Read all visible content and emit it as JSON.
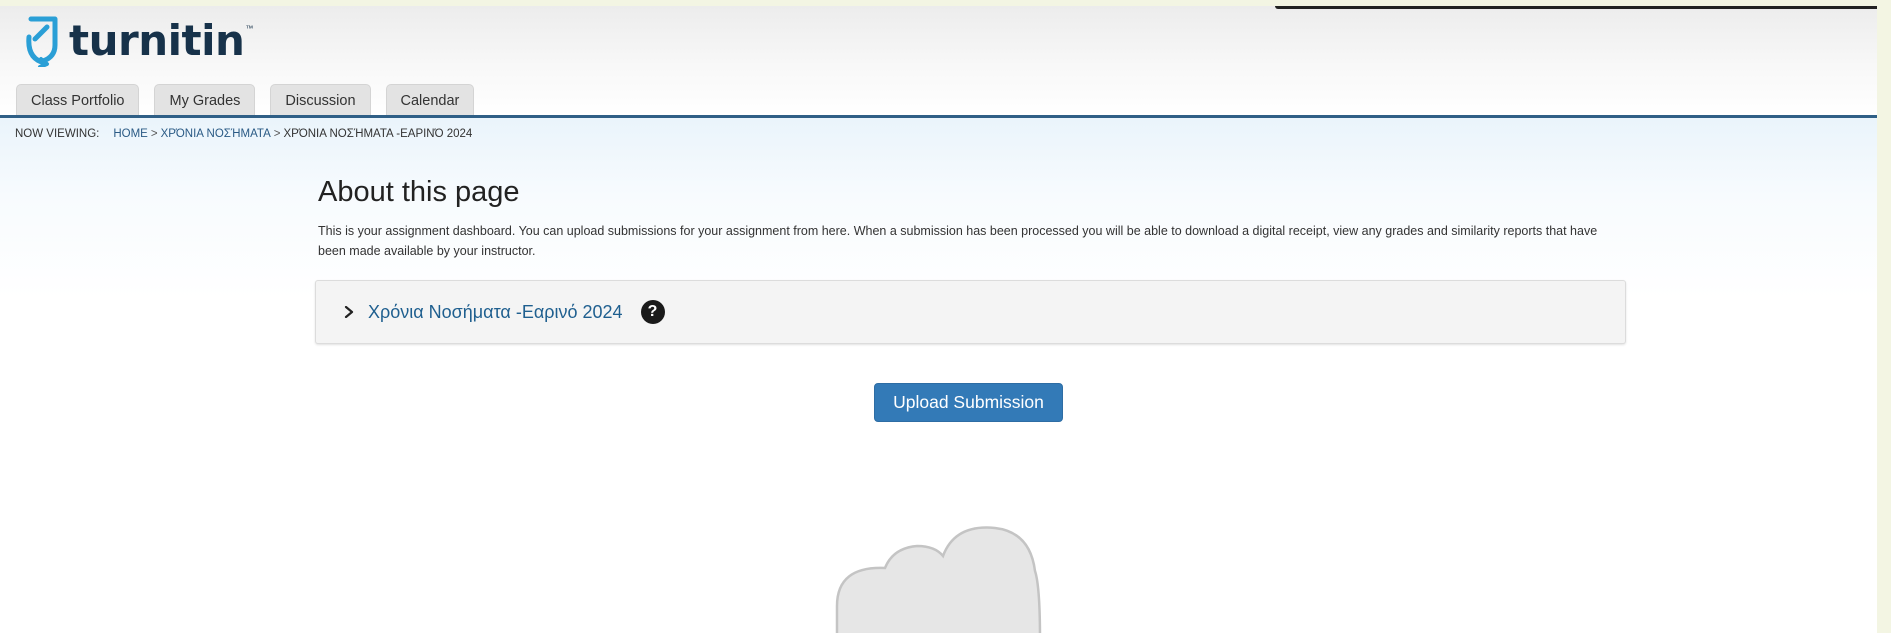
{
  "app": {
    "logo_text": "turnitin",
    "logo_tm": "™",
    "brand_color": "#2a9fd6",
    "text_color": "#17324a"
  },
  "tabs": [
    {
      "label": "Class Portfolio"
    },
    {
      "label": "My Grades"
    },
    {
      "label": "Discussion"
    },
    {
      "label": "Calendar"
    }
  ],
  "breadcrumb": {
    "label": "NOW VIEWING:",
    "items": [
      {
        "text": "HOME"
      },
      {
        "text": "ΧΡΌΝΙΑ ΝΟΣΉΜΑΤΑ"
      }
    ],
    "separator": ">",
    "current": "ΧΡΌΝΙΑ ΝΟΣΉΜΑΤΑ -ΕΑΡΙΝΌ 2024"
  },
  "about": {
    "title": "About this page",
    "description": "This is your assignment dashboard. You can upload submissions for your assignment from here. When a submission has been processed you will be able to download a digital receipt, view any grades and similarity reports that have been made available by your instructor."
  },
  "assignment": {
    "title": "Χρόνια Νοσήματα -Εαρινό 2024",
    "help_icon": "question-circle-icon",
    "expand_icon": "chevron-right-icon"
  },
  "upload": {
    "label": "Upload Submission",
    "color": "#337ab7"
  },
  "illustration": {
    "icon": "cloud-icon"
  }
}
